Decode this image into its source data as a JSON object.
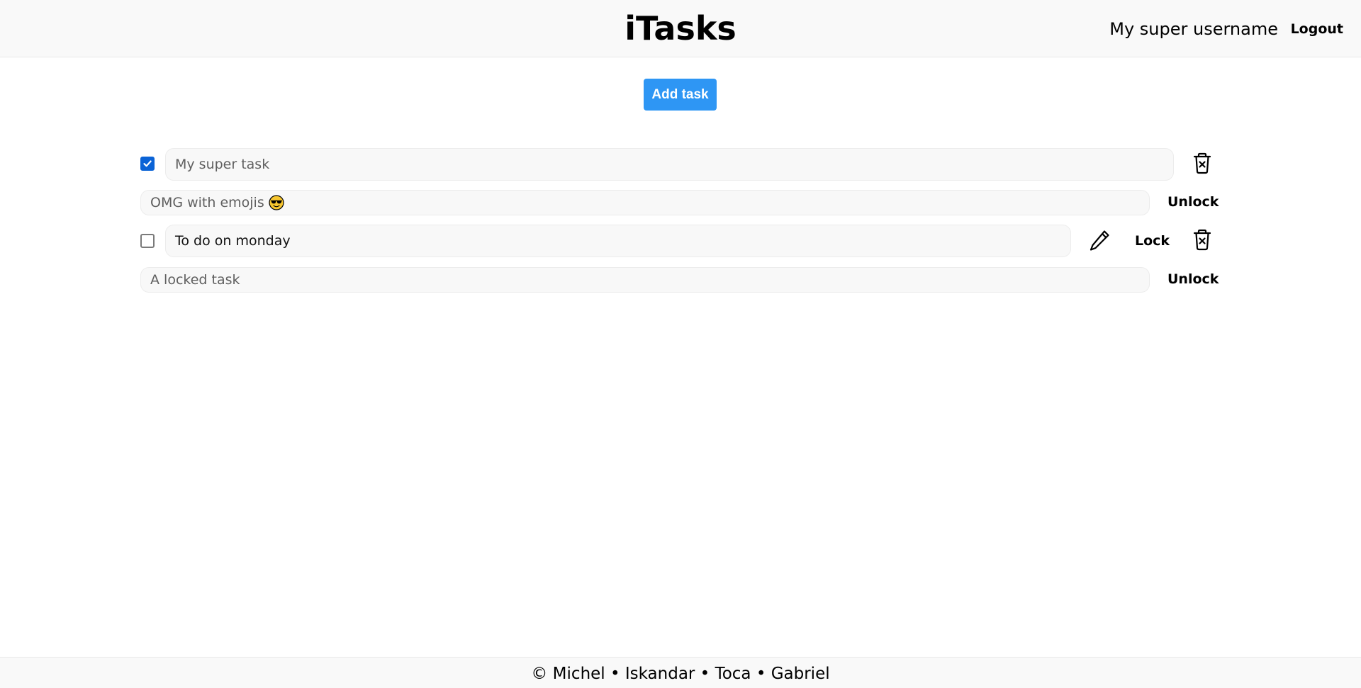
{
  "header": {
    "title": "iTasks",
    "username": "My super username",
    "logout_label": "Logout"
  },
  "toolbar": {
    "add_task_label": "Add task"
  },
  "tasks": [
    {
      "text": "My super task",
      "checked": true,
      "actions": [
        "delete-icon"
      ]
    },
    {
      "text": "OMG with emojis",
      "emoji": "smiling-face-with-sunglasses",
      "locked": true,
      "unlock_label": "Unlock"
    },
    {
      "text": "To do on monday",
      "checked": false,
      "lock_label": "Lock",
      "actions": [
        "pencil-icon",
        "delete-icon"
      ]
    },
    {
      "text": "A locked task",
      "locked": true,
      "unlock_label": "Unlock"
    }
  ],
  "footer": {
    "credits": "© Michel • Iskandar • Toca • Gabriel"
  },
  "colors": {
    "accent": "#2e96f4",
    "checkbox_checked": "#0b63d6",
    "header_bg": "#f9f9f9",
    "field_bg": "#f8f8f8"
  }
}
